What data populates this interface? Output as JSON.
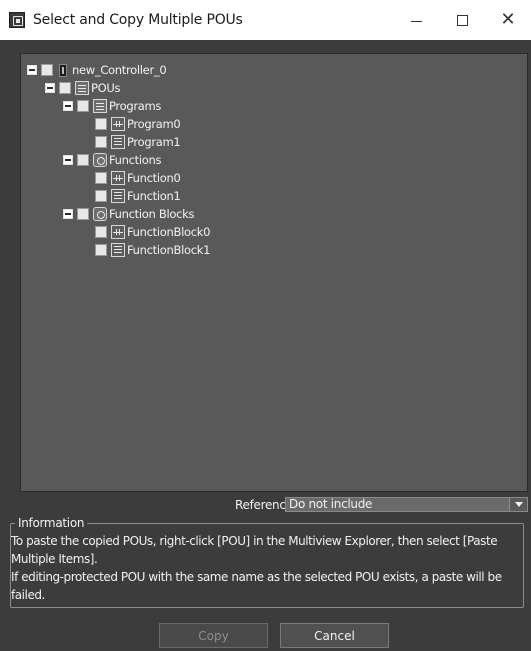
{
  "window": {
    "title": "Select and Copy Multiple POUs"
  },
  "titlebar": {
    "minimize_glyph": "—",
    "maximize_glyph": "☐",
    "close_glyph": "✕"
  },
  "tree": {
    "items": [
      {
        "label": "new_Controller_0",
        "level": 0,
        "expandable": true,
        "expanded": true,
        "checked": false,
        "icon": "controller-icon"
      },
      {
        "label": "POUs",
        "level": 1,
        "expandable": true,
        "expanded": true,
        "checked": false,
        "icon": "pou-folder-icon"
      },
      {
        "label": "Programs",
        "level": 2,
        "expandable": true,
        "expanded": true,
        "checked": false,
        "icon": "programs-folder-icon"
      },
      {
        "label": "Program0",
        "level": 3,
        "expandable": false,
        "checked": false,
        "icon": "ladder-icon"
      },
      {
        "label": "Program1",
        "level": 3,
        "expandable": false,
        "checked": false,
        "icon": "structured-text-icon"
      },
      {
        "label": "Functions",
        "level": 2,
        "expandable": true,
        "expanded": true,
        "checked": false,
        "icon": "functions-folder-icon"
      },
      {
        "label": "Function0",
        "level": 3,
        "expandable": false,
        "checked": false,
        "icon": "ladder-icon"
      },
      {
        "label": "Function1",
        "level": 3,
        "expandable": false,
        "checked": false,
        "icon": "structured-text-icon"
      },
      {
        "label": "Function Blocks",
        "level": 2,
        "expandable": true,
        "expanded": true,
        "checked": false,
        "icon": "function-blocks-folder-icon"
      },
      {
        "label": "FunctionBlock0",
        "level": 3,
        "expandable": false,
        "checked": false,
        "icon": "ladder-icon"
      },
      {
        "label": "FunctionBlock1",
        "level": 3,
        "expandable": false,
        "checked": false,
        "icon": "structured-text-icon"
      }
    ]
  },
  "reference": {
    "label": "Reference :",
    "selected": "Do not include"
  },
  "information": {
    "legend": "Information",
    "line1": "To paste the copied POUs, right-click [POU] in the Multiview Explorer, then select [Paste Multiple Items].",
    "line2": "If editing-protected POU with the same name as the selected POU exists, a paste will be failed."
  },
  "buttons": {
    "copy": "Copy",
    "copy_enabled": false,
    "cancel": "Cancel"
  }
}
